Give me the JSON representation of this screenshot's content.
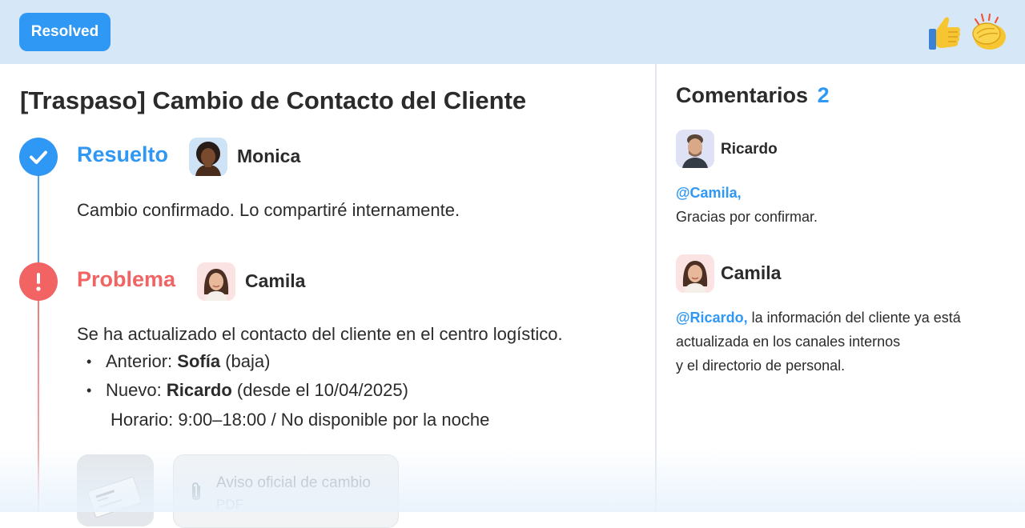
{
  "header": {
    "status_badge": "Resolved",
    "reactions": [
      "thumbs-up-icon",
      "clapping-hands-icon"
    ]
  },
  "ticket": {
    "title": "[Traspaso] Cambio de Contacto del Cliente",
    "events": [
      {
        "status": "Resuelto",
        "status_color": "#2f97f4",
        "author": "Monica",
        "text": "Cambio confirmado. Lo compartiré internamente."
      },
      {
        "status": "Problema",
        "status_color": "#f06464",
        "author": "Camila",
        "text": "Se ha actualizado el contacto del cliente en el centro logístico.",
        "bullets": [
          {
            "label": "Anterior:",
            "name": "Sofía",
            "note": "(baja)"
          },
          {
            "label": "Nuevo:",
            "name": "Ricardo",
            "note": "(desde el 10/04/2025)"
          }
        ],
        "schedule": "Horario: 9:00–18:00 / No disponible por la noche",
        "attachment": {
          "title": "Aviso oficial de cambio",
          "type": "PDF"
        }
      }
    ]
  },
  "comments": {
    "title": "Comentarios",
    "count": "2",
    "items": [
      {
        "author": "Ricardo",
        "mention": "@Camila,",
        "lines": [
          "Gracias por confirmar."
        ]
      },
      {
        "author": "Camila",
        "mention": "@Ricardo,",
        "lines": [
          "la información del cliente ya está",
          "actualizada en los canales internos",
          "y el directorio de personal."
        ]
      }
    ]
  },
  "colors": {
    "accent": "#2f97f4",
    "problem": "#f06464",
    "header_bg": "#d6e8f8"
  }
}
